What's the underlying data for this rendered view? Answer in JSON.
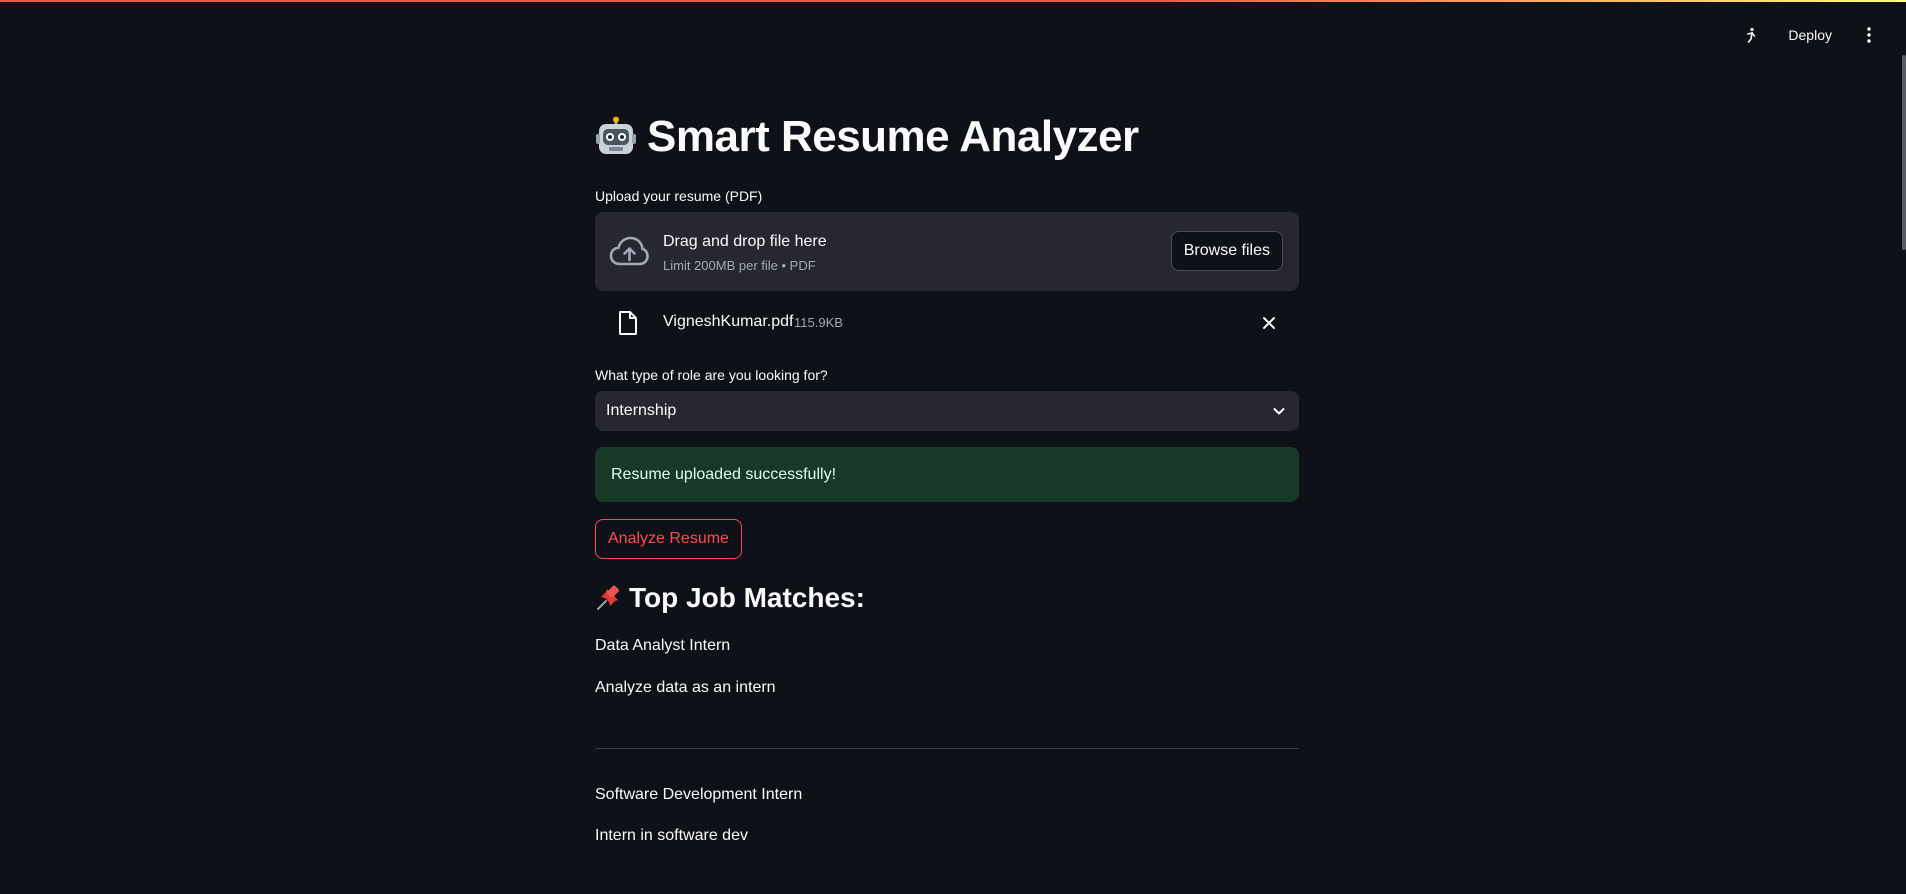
{
  "toolbar": {
    "deploy_label": "Deploy"
  },
  "header": {
    "title": "Smart Resume Analyzer",
    "title_icon": "robot-emoji"
  },
  "uploader": {
    "label": "Upload your resume (PDF)",
    "drop_title": "Drag and drop file here",
    "drop_subtitle": "Limit 200MB per file • PDF",
    "browse_label": "Browse files",
    "file": {
      "name": "VigneshKumar.pdf",
      "size": "115.9KB"
    }
  },
  "role_select": {
    "label": "What type of role are you looking for?",
    "selected": "Internship"
  },
  "alert": {
    "message": "Resume uploaded successfully!"
  },
  "analyze_button": {
    "label": "Analyze Resume"
  },
  "matches": {
    "heading": "Top Job Matches:",
    "heading_icon": "pushpin-emoji",
    "items": [
      {
        "title": "Data Analyst Intern",
        "description": "Analyze data as an intern"
      },
      {
        "title": "Software Development Intern",
        "description": "Intern in software dev"
      }
    ]
  },
  "colors": {
    "background": "#0e1117",
    "surface": "#262730",
    "primary": "#ff4b4b",
    "success_bg": "#173928",
    "success_text": "#dffde9",
    "muted_text": "#a3a8b8"
  }
}
